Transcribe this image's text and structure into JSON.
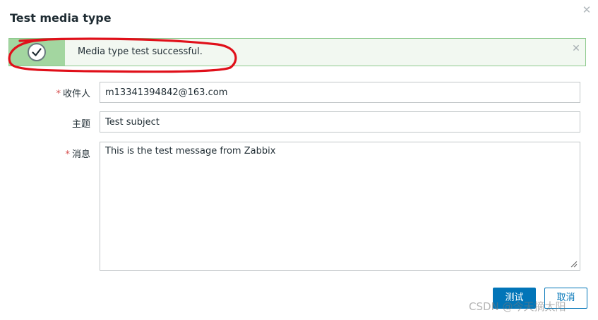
{
  "dialog": {
    "title": "Test media type",
    "close_icon": "close-icon"
  },
  "message": {
    "text": "Media type test successful.",
    "status_icon": "check-circle-icon",
    "dismiss_icon": "close-icon",
    "accent_color": "#a3d6a0"
  },
  "form": {
    "recipient": {
      "label": "收件人",
      "required": "*",
      "value": "m13341394842@163.com"
    },
    "subject": {
      "label": "主题",
      "value": "Test subject"
    },
    "message": {
      "label": "消息",
      "required": "*",
      "value": "This is the test message from Zabbix"
    }
  },
  "buttons": {
    "test": "测试",
    "cancel": "取消"
  },
  "watermark": "CSDN @今天摘太阳",
  "colors": {
    "primary": "#0275b8",
    "required": "#d64e4e",
    "annotation": "#e0101a"
  }
}
